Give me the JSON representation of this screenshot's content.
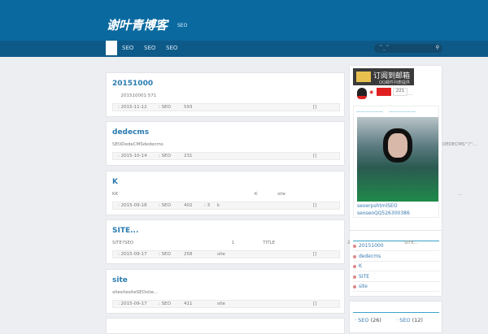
{
  "header": {
    "logo": "谢叶青博客",
    "tagline": "SEO"
  },
  "nav": {
    "items": [
      "SEO",
      "SEO",
      "SEO"
    ],
    "search_placeholder": "^_^"
  },
  "posts": [
    {
      "title": "20151000",
      "excerpt": "      201510001 571",
      "date": ": 2015-11-12",
      "cat": ": SEO",
      "views": "593",
      "extra": "",
      "tag": "",
      "comments": "[]"
    },
    {
      "title": "dedecms",
      "excerpt": "SEODedeCMSdedecms",
      "date": ": 2015-10-14",
      "cat": ": SEO",
      "views": "231",
      "extra": "",
      "tag": "",
      "comments": "[]"
    },
    {
      "title": "K",
      "excerpt": "KK                                                                                                K              site",
      "date": ": 2015-09-18",
      "cat": ": SEO",
      "views": "402",
      "extra": ": 3",
      "tag": "k",
      "comments": "[]"
    },
    {
      "title": "SITE...",
      "excerpt": "SITE?SEO                                                                     1                    TITLE",
      "date": ": 2015-09-17",
      "cat": ": SEO",
      "views": "258",
      "extra": "",
      "tag": "site",
      "comments": "[]"
    },
    {
      "title": "site",
      "excerpt": "sitesitesiteSEOsite...",
      "date": ": 2015-09-17",
      "cat": ": SEO",
      "views": "411",
      "extra": "",
      "tag": "site",
      "comments": "[]"
    }
  ],
  "sidebar": {
    "subscribe": "订阅到邮箱",
    "subscribe_sub": "QQ邮件列表提供",
    "follow_count": "221",
    "dots": "...",
    "photo_caption": "——————    ——————",
    "links": [
      "seoerpshtmlSEO",
      "seoseoQQ526300386"
    ],
    "overflow1": "DEDECMS'''/''...",
    "overflow2": "...",
    "overflow3": "2",
    "overflow4": "SITE...",
    "recent": [
      "20151000",
      "dedecms",
      "K",
      "SITE",
      "site"
    ],
    "categories": [
      {
        "name": "SEO",
        "count": "(26)"
      },
      {
        "name": "SEO",
        "count": "(12)"
      }
    ]
  }
}
